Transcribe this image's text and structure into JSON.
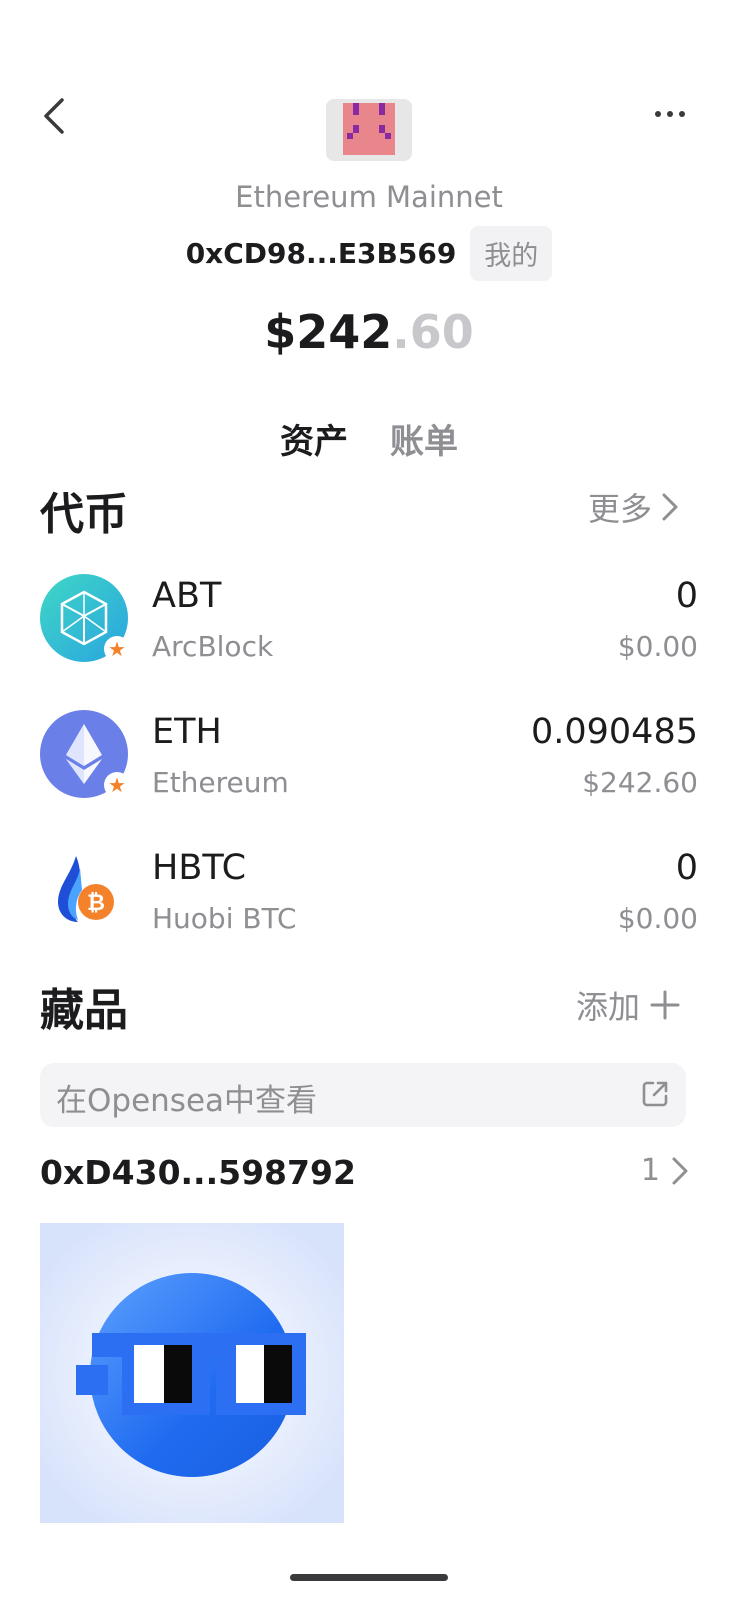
{
  "header": {
    "network": "Ethereum Mainnet",
    "address": "0xCD98...E3B569",
    "mine_badge": "我的"
  },
  "balance": {
    "whole": "$242",
    "decimal": ".60"
  },
  "tabs": [
    {
      "label": "资产",
      "active": true
    },
    {
      "label": "账单",
      "active": false
    }
  ],
  "tokens_section": {
    "title": "代币",
    "action": "更多"
  },
  "tokens": [
    {
      "symbol": "ABT",
      "name": "ArcBlock",
      "amount": "0",
      "fiat": "$0.00",
      "icon": "arcblock-icon",
      "starred": true
    },
    {
      "symbol": "ETH",
      "name": "Ethereum",
      "amount": "0.090485",
      "fiat": "$242.60",
      "icon": "ethereum-icon",
      "starred": true
    },
    {
      "symbol": "HBTC",
      "name": "Huobi BTC",
      "amount": "0",
      "fiat": "$0.00",
      "icon": "hbtc-icon",
      "starred": false
    }
  ],
  "collectibles_section": {
    "title": "藏品",
    "action": "添加"
  },
  "opensea": {
    "label": "在Opensea中查看"
  },
  "collection": {
    "address": "0xD430...598792",
    "count": "1"
  },
  "colors": {
    "accent_orange": "#f4822a",
    "eth_purple": "#6b7fe8",
    "abt_teal": "#3fd7c5",
    "nft_blue": "#1f6bf0"
  }
}
